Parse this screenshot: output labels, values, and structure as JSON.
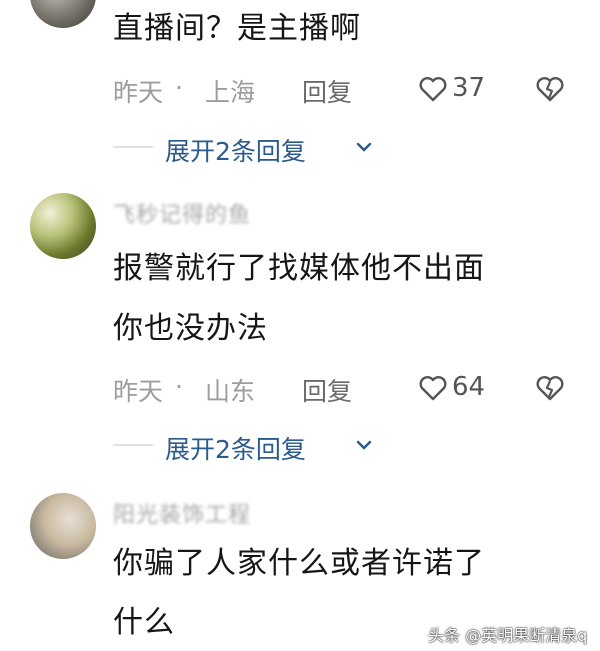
{
  "comments": [
    {
      "username": "",
      "text_lines": [
        "直播间？是主播啊"
      ],
      "time": "昨天",
      "separator": "·",
      "location": "上海",
      "reply_label": "回复",
      "likes": "37",
      "expand_label": "展开2条回复"
    },
    {
      "username": "飞秒记得的鱼",
      "text_lines": [
        "报警就行了找媒体他不出面",
        "你也没办法"
      ],
      "time": "昨天",
      "separator": "·",
      "location": "山东",
      "reply_label": "回复",
      "likes": "64",
      "expand_label": "展开2条回复"
    },
    {
      "username": "阳光装饰工程",
      "text_lines": [
        "你骗了人家什么或者许诺了",
        "什么"
      ]
    }
  ],
  "watermark": "头条 @英明果断清泉q",
  "colors": {
    "link": "#2b5a8c",
    "meta": "#9d9d9d",
    "text": "#161616"
  }
}
